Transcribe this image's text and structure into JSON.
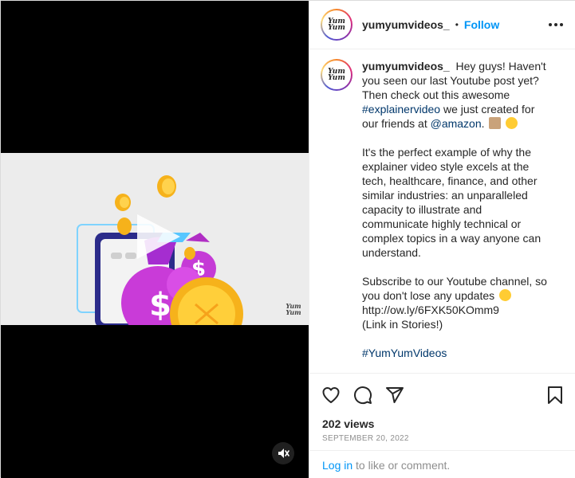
{
  "post": {
    "username": "yumyumvideos_",
    "separator": "•",
    "follow_label": "Follow",
    "avatar_logo": "Yum Yum",
    "caption": {
      "intro": "Hey guys! Haven't you seen our last Youtube post yet? Then check out this awesome",
      "hashtag_explainer": "#explainervideo",
      "mid": "we just created for our friends at",
      "mention": "@amazon",
      "period": ".",
      "para2": "It's the perfect example of why the explainer video style excels at the tech, healthcare, finance, and other similar industries: an unparalleled capacity to illustrate and communicate highly technical or complex topics in a way anyone can understand.",
      "para3": "Subscribe to our Youtube channel, so you don't lose any updates",
      "url": "http://ow.ly/6FXK50KOmm9",
      "link_note": "(Link in Stories!)",
      "hashtag_brand": "#YumYumVideos"
    },
    "views": "202 views",
    "date": "SEPTEMBER 20, 2022",
    "login_link": "Log in",
    "login_suffix": " to like or comment.",
    "video_watermark": "Yum Yum"
  },
  "icons": {
    "like": "heart-icon",
    "comment": "comment-icon",
    "share": "share-icon",
    "save": "bookmark-icon",
    "more": "more-options-icon",
    "mute": "muted-speaker-icon",
    "play": "play-icon"
  },
  "colors": {
    "link": "#00376b",
    "follow": "#0095f6",
    "muted_text": "#8e8e8e"
  }
}
